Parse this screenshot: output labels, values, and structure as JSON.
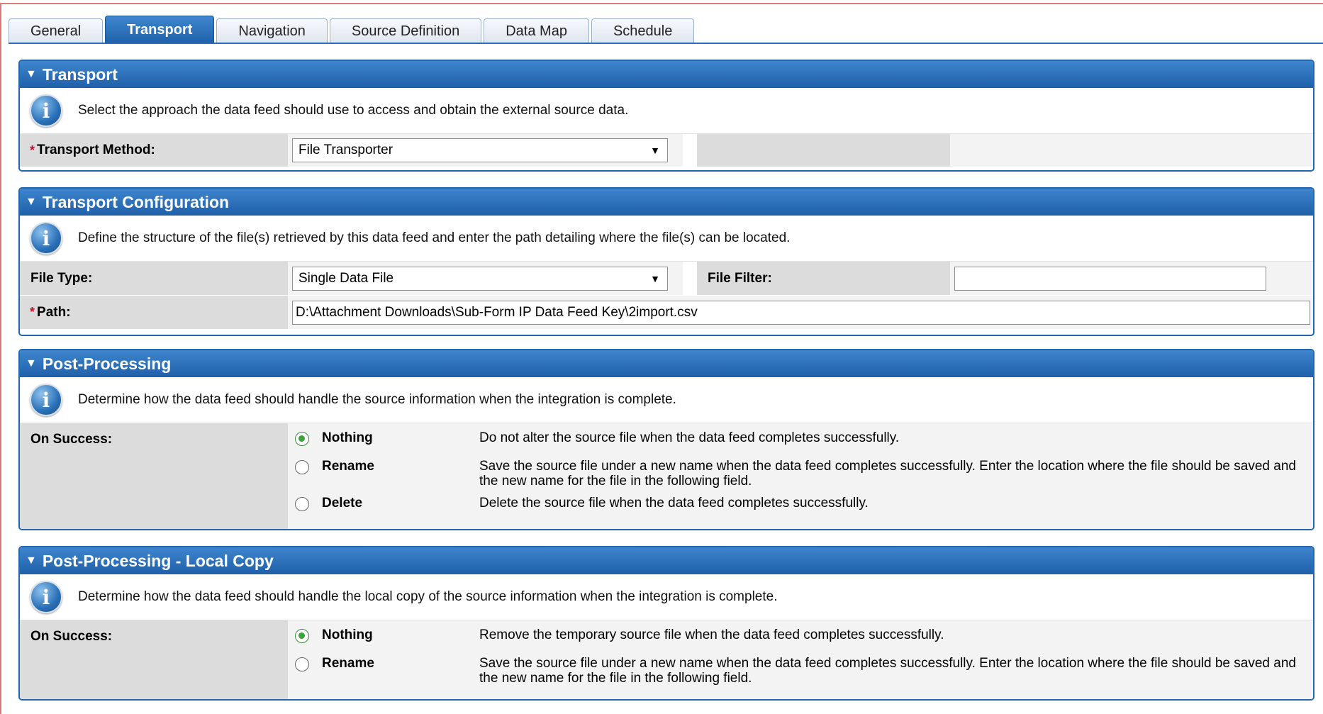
{
  "tabs": [
    "General",
    "Transport",
    "Navigation",
    "Source Definition",
    "Data Map",
    "Schedule"
  ],
  "active_tab": "Transport",
  "transport": {
    "title": "Transport",
    "info": "Select the approach the data feed should use to access and obtain the external source data.",
    "method_label": "Transport Method:",
    "method_value": "File Transporter",
    "required_marker": "*"
  },
  "config": {
    "title": "Transport Configuration",
    "info": "Define the structure of the file(s) retrieved by this data feed and enter the path detailing where the file(s) can be located.",
    "file_type_label": "File Type:",
    "file_type_value": "Single Data File",
    "file_filter_label": "File Filter:",
    "file_filter_value": "",
    "path_label": "Path:",
    "path_value": "D:\\Attachment Downloads\\Sub-Form IP Data Feed Key\\2import.csv",
    "required_marker": "*"
  },
  "post": {
    "title": "Post-Processing",
    "info": "Determine how the data feed should handle the source information when the integration is complete.",
    "on_success_label": "On Success:",
    "options": [
      {
        "label": "Nothing",
        "desc": "Do not alter the source file when the data feed completes successfully.",
        "checked": true
      },
      {
        "label": "Rename",
        "desc": "Save the source file under a new name when the data feed completes successfully.  Enter the location where the file should be saved and the new name for the file in the following field.",
        "checked": false
      },
      {
        "label": "Delete",
        "desc": "Delete the source file when the data feed completes successfully.",
        "checked": false
      }
    ]
  },
  "local": {
    "title": "Post-Processing - Local Copy",
    "info": "Determine how the data feed should handle the local copy of the source information when the integration is complete.",
    "on_success_label": "On Success:",
    "options": [
      {
        "label": "Nothing",
        "desc": "Remove the temporary source file when the data feed completes successfully.",
        "checked": true
      },
      {
        "label": "Rename",
        "desc": "Save the source file under a new name when the data feed completes successfully.  Enter the location where the file should be saved and the new name for the file in the following field.",
        "checked": false
      }
    ]
  },
  "icons": {
    "collapse": "triangle-down-icon",
    "info": "info-icon",
    "dropdown": "dropdown-arrow-icon"
  }
}
